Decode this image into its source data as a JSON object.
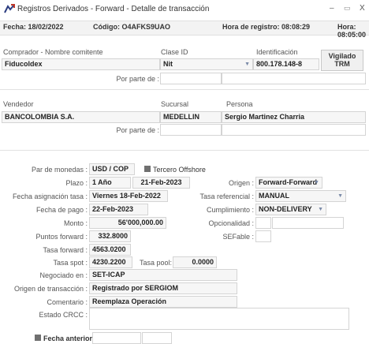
{
  "window": {
    "title": "Registros Derivados - Forward - Detalle de transacción",
    "minimize": "–",
    "maximize": "▭",
    "close": "X"
  },
  "header": {
    "fecha": "Fecha: 18/02/2022",
    "codigo": "Código: O4AFKS9UAO",
    "hora_registro": "Hora de registro: 08:08:29",
    "hora": "Hora: 08:05:00"
  },
  "comprador": {
    "label_nombre": "Comprador - Nombre comitente",
    "nombre": "Fiducoldex",
    "label_clase": "Clase ID",
    "clase": "Nit",
    "label_id": "Identificación",
    "id": "800.178.148-8",
    "por_parte_label": "Por parte de :",
    "vigilado_btn": "Vigilado TRM"
  },
  "vendedor": {
    "label_nombre": "Vendedor",
    "nombre": "BANCOLOMBIA S.A.",
    "label_sucursal": "Sucursal",
    "sucursal": "MEDELLIN",
    "label_persona": "Persona",
    "persona": "Sergio Martinez Charria",
    "por_parte_label": "Por parte de :"
  },
  "detalle": {
    "par_label": "Par de monedas :",
    "par": "USD / COP",
    "tercero_label": "Tercero Offshore",
    "plazo_label": "Plazo :",
    "plazo": "1 Año",
    "plazo_fecha": "21-Feb-2023",
    "origen_label": "Origen :",
    "origen": "Forward-Forward",
    "fecha_asig_label": "Fecha asignación tasa :",
    "fecha_asig": "Viernes 18-Feb-2022",
    "tasa_ref_label": "Tasa referencial :",
    "tasa_ref": "MANUAL",
    "fecha_pago_label": "Fecha de pago :",
    "fecha_pago": "22-Feb-2023",
    "cumplimiento_label": "Cumplimiento :",
    "cumplimiento": "NON-DELIVERY",
    "monto_label": "Monto :",
    "monto": "56'000,000.00",
    "opcionalidad_label": "Opcionalidad :",
    "puntos_label": "Puntos forward :",
    "puntos": "332.8000",
    "sefable_label": "SEFable :",
    "tasa_fwd_label": "Tasa forward :",
    "tasa_fwd": "4563.0200",
    "tasa_spot_label": "Tasa spot :",
    "tasa_spot": "4230.2200",
    "tasa_pool_label": "Tasa pool:",
    "tasa_pool": "0.0000",
    "negociado_label": "Negociado en :",
    "negociado": "SET-ICAP",
    "origen_trans_label": "Origen de transacción :",
    "origen_trans": "Registrado por SERGIOM",
    "comentario_label": "Comentario :",
    "comentario": "Reemplaza Operación",
    "estado_label": "Estado CRCC :",
    "fecha_anterior_label": "Fecha anterior"
  },
  "colors": {
    "header_bg": "#f3f3f3",
    "field_bg": "#f6f6f6",
    "arrow": "#7a8aa8",
    "checkbox": "#707070"
  },
  "icons": {
    "app": "forward-app-icon",
    "dropdown": "chevron-down-icon"
  }
}
